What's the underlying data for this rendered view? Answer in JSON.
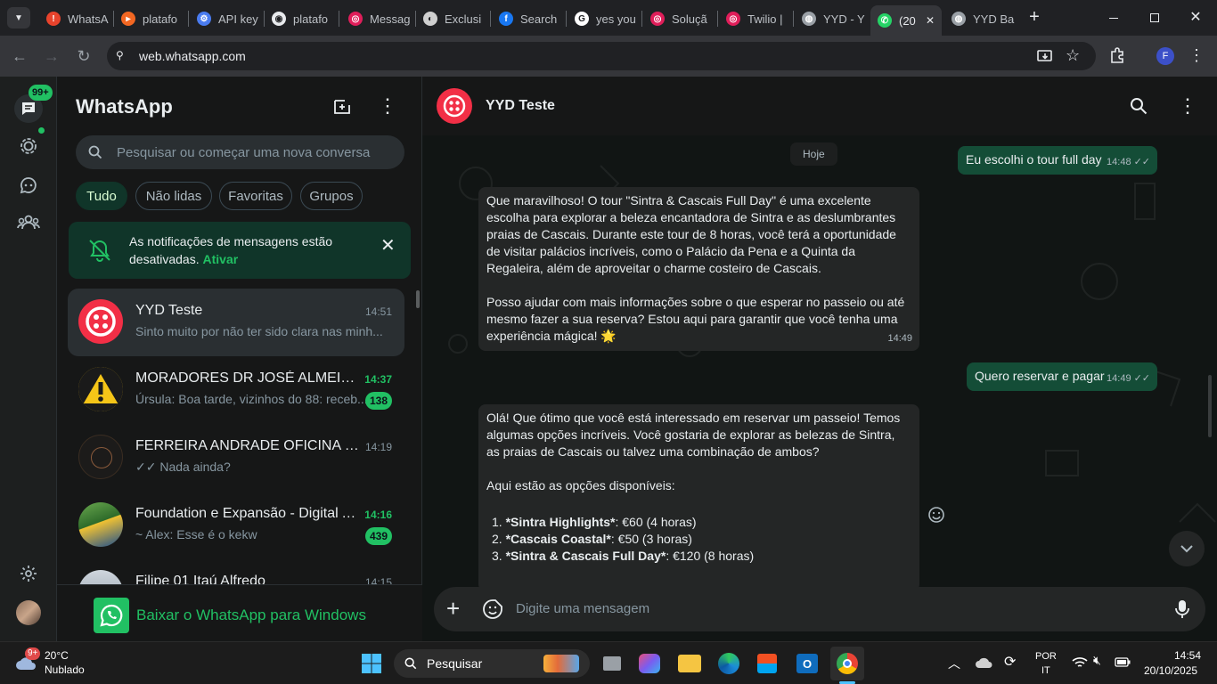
{
  "browser": {
    "tabs": [
      {
        "label": "WhatsA",
        "color": "#e8432c",
        "glyph": "!"
      },
      {
        "label": "platafo",
        "color": "#f26722",
        "glyph": "▸"
      },
      {
        "label": "API key",
        "color": "#4a7cf0",
        "glyph": "⚙"
      },
      {
        "label": "platafo",
        "color": "#e8eaed",
        "glyph": "◉"
      },
      {
        "label": "Messag",
        "color": "#e01e5a",
        "glyph": "◎"
      },
      {
        "label": "Exclusi",
        "color": "#cfcfcf",
        "glyph": "◐"
      },
      {
        "label": "Search",
        "color": "#1877f2",
        "glyph": "f"
      },
      {
        "label": "yes you",
        "color": "#ffffff",
        "glyph": "G"
      },
      {
        "label": "Soluçã",
        "color": "#e01e5a",
        "glyph": "◎"
      },
      {
        "label": "Twilio |",
        "color": "#e01e5a",
        "glyph": "◎"
      },
      {
        "label": "YYD - Y",
        "color": "#9aa0a6",
        "glyph": "◍"
      },
      {
        "label": "(20",
        "color": "#25d366",
        "glyph": "✆"
      },
      {
        "label": "YYD Ba",
        "color": "#9aa0a6",
        "glyph": "◍"
      }
    ],
    "url": "web.whatsapp.com",
    "profile_initial": "F"
  },
  "rail": {
    "chats_badge": "99+"
  },
  "sidebar": {
    "title": "WhatsApp",
    "search_placeholder": "Pesquisar ou começar uma nova conversa",
    "filters": [
      "Tudo",
      "Não lidas",
      "Favoritas",
      "Grupos"
    ],
    "notice": {
      "text": "As notificações de mensagens estão desativadas.",
      "action": "Ativar"
    },
    "chats": [
      {
        "name": "YYD Teste",
        "time": "14:51",
        "last": "Sinto muito por não ter sido clara nas minh...",
        "badge": "",
        "time_green": false
      },
      {
        "name": "MORADORES DR JOSÉ ALMEIDA",
        "time": "14:37",
        "last": "Úrsula: Boa tarde, vizinhos do 88: receb...",
        "badge": "138",
        "time_green": true
      },
      {
        "name": "FERREIRA ANDRADE OFICINA ESP...",
        "time": "14:19",
        "last": "✓✓ Nada ainda?",
        "badge": "",
        "time_green": false
      },
      {
        "name": "Foundation e Expansão - Digital A...",
        "time": "14:16",
        "last": "~ Alex: Esse é o kekw",
        "badge": "439",
        "time_green": true
      },
      {
        "name": "Filipe 01 Itaú Alfredo",
        "time": "14:15",
        "last": "",
        "badge": "",
        "time_green": false
      }
    ],
    "download_banner": "Baixar o WhatsApp para Windows"
  },
  "chat": {
    "contact_name": "YYD Teste",
    "date_chip": "Hoje",
    "messages": [
      {
        "dir": "out",
        "time": "14:48",
        "text": "Eu escolhi o tour full day"
      },
      {
        "dir": "in",
        "time": "14:49",
        "paragraphs": [
          "Que maravilhoso! O tour \"Sintra & Cascais Full Day\" é uma excelente escolha para explorar a beleza encantadora de Sintra e as deslumbrantes praias de Cascais. Durante este tour de 8 horas, você terá a oportunidade de visitar palácios incríveis, como o Palácio da Pena e a Quinta da Regaleira, além de aproveitar o charme costeiro de Cascais.",
          "Posso ajudar com mais informações sobre o que esperar no passeio ou até mesmo fazer a sua reserva? Estou aqui para garantir que você tenha uma experiência mágica! 🌟"
        ]
      },
      {
        "dir": "out",
        "time": "14:49",
        "text": "Quero reservar e pagar"
      },
      {
        "dir": "in",
        "time": "",
        "paragraphs": [
          "Olá! Que ótimo que você está interessado em reservar um passeio! Temos algumas opções incríveis. Você gostaria de explorar as belezas de Sintra, as praias de Cascais ou talvez uma combinação de ambos?",
          "Aqui estão as opções disponíveis:"
        ],
        "list": [
          {
            "n": "1.",
            "bold": "*Sintra Highlights*",
            "rest": ": €60 (4 horas)"
          },
          {
            "n": "2.",
            "bold": "*Cascais Coastal*",
            "rest": ": €50 (3 horas)"
          },
          {
            "n": "3.",
            "bold": "*Sintra & Cascais Full Day*",
            "rest": ": €120 (8 horas)"
          }
        ]
      }
    ],
    "composer_placeholder": "Digite uma mensagem"
  },
  "taskbar": {
    "weather_temp": "20°C",
    "weather_desc": "Nublado",
    "weather_badge": "9+",
    "search_label": "Pesquisar",
    "lang_top": "POR",
    "lang_bottom": "IT",
    "clock_time": "14:54",
    "clock_date": "20/10/2025"
  },
  "colors": {
    "accent_green": "#21c063",
    "bubble_out": "#144d37",
    "bubble_in": "#242626",
    "twilio_red": "#f22f46"
  }
}
